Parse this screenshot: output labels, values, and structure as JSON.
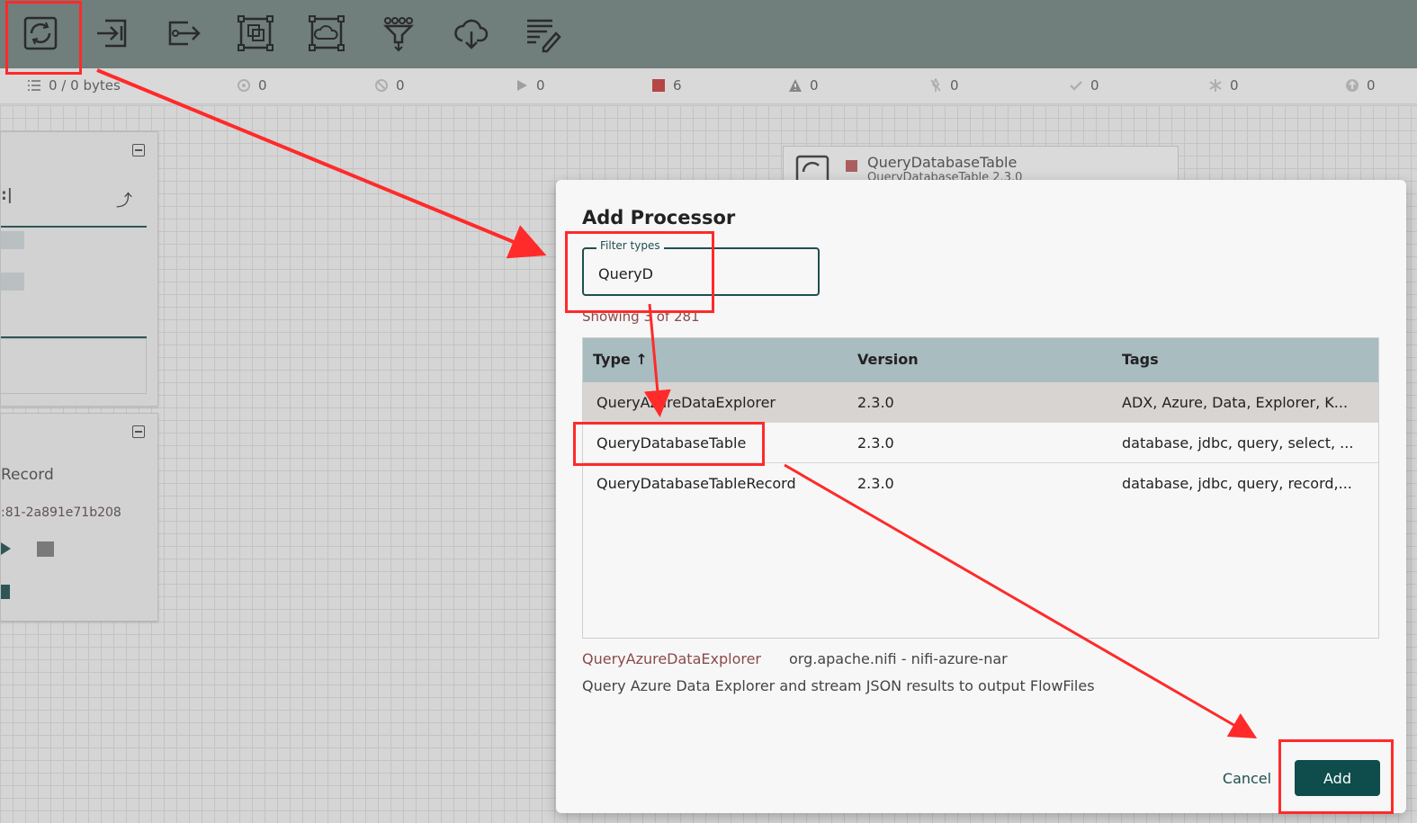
{
  "toolbar": {
    "tools": [
      {
        "name": "processor-tool",
        "icon": "processor-icon"
      },
      {
        "name": "input-port-tool",
        "icon": "input-port-icon"
      },
      {
        "name": "output-port-tool",
        "icon": "output-port-icon"
      },
      {
        "name": "process-group-tool",
        "icon": "process-group-icon"
      },
      {
        "name": "remote-process-group-tool",
        "icon": "remote-process-group-icon"
      },
      {
        "name": "funnel-tool",
        "icon": "funnel-icon"
      },
      {
        "name": "template-tool",
        "icon": "template-icon"
      },
      {
        "name": "label-tool",
        "icon": "label-icon"
      }
    ]
  },
  "statusbar": {
    "queued": "0 / 0 bytes",
    "transmitting": "0",
    "not_transmitting": "0",
    "running": "0",
    "stopped": "6",
    "invalid": "0",
    "disabled": "0",
    "up_to_date": "0",
    "locally_modified": "0",
    "sync_failure": "0"
  },
  "left_panels": {
    "panel2_name": "Record",
    "panel2_id": ":81-2a891e71b208"
  },
  "background_processor": {
    "name": "QueryDatabaseTable",
    "subtitle": "QueryDatabaseTable 2.3.0"
  },
  "dialog": {
    "title": "Add Processor",
    "filter_label": "Filter types",
    "filter_value": "QueryD",
    "showing": "Showing 3 of 281",
    "columns": {
      "type": "Type ↑",
      "version": "Version",
      "tags": "Tags"
    },
    "rows": [
      {
        "type": "QueryAzureDataExplorer",
        "version": "2.3.0",
        "tags": "ADX, Azure, Data, Explorer, K...",
        "selected": true
      },
      {
        "type": "QueryDatabaseTable",
        "version": "2.3.0",
        "tags": "database, jdbc, query, select, ...",
        "selected": false
      },
      {
        "type": "QueryDatabaseTableRecord",
        "version": "2.3.0",
        "tags": "database, jdbc, query, record,...",
        "selected": false
      }
    ],
    "selected_type": "QueryAzureDataExplorer",
    "selected_bundle": "org.apache.nifi - nifi-azure-nar",
    "selected_description": "Query Azure Data Explorer and stream JSON results to output FlowFiles",
    "cancel_label": "Cancel",
    "add_label": "Add"
  },
  "colors": {
    "toolbar": "#6e7f7d",
    "primary": "#0f4c4c",
    "table_header": "#a9bcc0",
    "annotation": "#ff2a2a",
    "stopped": "#c43a3a"
  }
}
